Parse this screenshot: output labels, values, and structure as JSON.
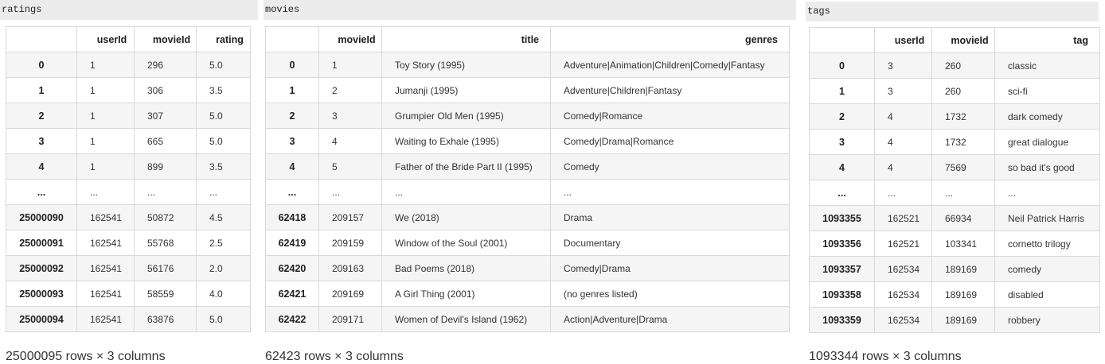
{
  "ratings": {
    "name": "ratings",
    "columns": [
      "userId",
      "movieId",
      "rating"
    ],
    "rows": [
      [
        "0",
        "1",
        "296",
        "5.0"
      ],
      [
        "1",
        "1",
        "306",
        "3.5"
      ],
      [
        "2",
        "1",
        "307",
        "5.0"
      ],
      [
        "3",
        "1",
        "665",
        "5.0"
      ],
      [
        "4",
        "1",
        "899",
        "3.5"
      ],
      [
        "...",
        "...",
        "...",
        "..."
      ],
      [
        "25000090",
        "162541",
        "50872",
        "4.5"
      ],
      [
        "25000091",
        "162541",
        "55768",
        "2.5"
      ],
      [
        "25000092",
        "162541",
        "56176",
        "2.0"
      ],
      [
        "25000093",
        "162541",
        "58559",
        "4.0"
      ],
      [
        "25000094",
        "162541",
        "63876",
        "5.0"
      ]
    ],
    "footer": "25000095 rows × 3 columns"
  },
  "movies": {
    "name": "movies",
    "columns": [
      "movieId",
      "title",
      "genres"
    ],
    "rows": [
      [
        "0",
        "1",
        "Toy Story (1995)",
        "Adventure|Animation|Children|Comedy|Fantasy"
      ],
      [
        "1",
        "2",
        "Jumanji (1995)",
        "Adventure|Children|Fantasy"
      ],
      [
        "2",
        "3",
        "Grumpier Old Men (1995)",
        "Comedy|Romance"
      ],
      [
        "3",
        "4",
        "Waiting to Exhale (1995)",
        "Comedy|Drama|Romance"
      ],
      [
        "4",
        "5",
        "Father of the Bride Part II (1995)",
        "Comedy"
      ],
      [
        "...",
        "...",
        "...",
        "..."
      ],
      [
        "62418",
        "209157",
        "We (2018)",
        "Drama"
      ],
      [
        "62419",
        "209159",
        "Window of the Soul (2001)",
        "Documentary"
      ],
      [
        "62420",
        "209163",
        "Bad Poems (2018)",
        "Comedy|Drama"
      ],
      [
        "62421",
        "209169",
        "A Girl Thing (2001)",
        "(no genres listed)"
      ],
      [
        "62422",
        "209171",
        "Women of Devil's Island (1962)",
        "Action|Adventure|Drama"
      ]
    ],
    "footer": "62423 rows × 3 columns"
  },
  "tags": {
    "name": "tags",
    "columns": [
      "userId",
      "movieId",
      "tag"
    ],
    "rows": [
      [
        "0",
        "3",
        "260",
        "classic"
      ],
      [
        "1",
        "3",
        "260",
        "sci-fi"
      ],
      [
        "2",
        "4",
        "1732",
        "dark comedy"
      ],
      [
        "3",
        "4",
        "1732",
        "great dialogue"
      ],
      [
        "4",
        "4",
        "7569",
        "so bad it's good"
      ],
      [
        "...",
        "...",
        "...",
        "..."
      ],
      [
        "1093355",
        "162521",
        "66934",
        "Neil Patrick Harris"
      ],
      [
        "1093356",
        "162521",
        "103341",
        "cornetto trilogy"
      ],
      [
        "1093357",
        "162534",
        "189169",
        "comedy"
      ],
      [
        "1093358",
        "162534",
        "189169",
        "disabled"
      ],
      [
        "1093359",
        "162534",
        "189169",
        "robbery"
      ]
    ],
    "footer": "1093344 rows × 3 columns"
  }
}
